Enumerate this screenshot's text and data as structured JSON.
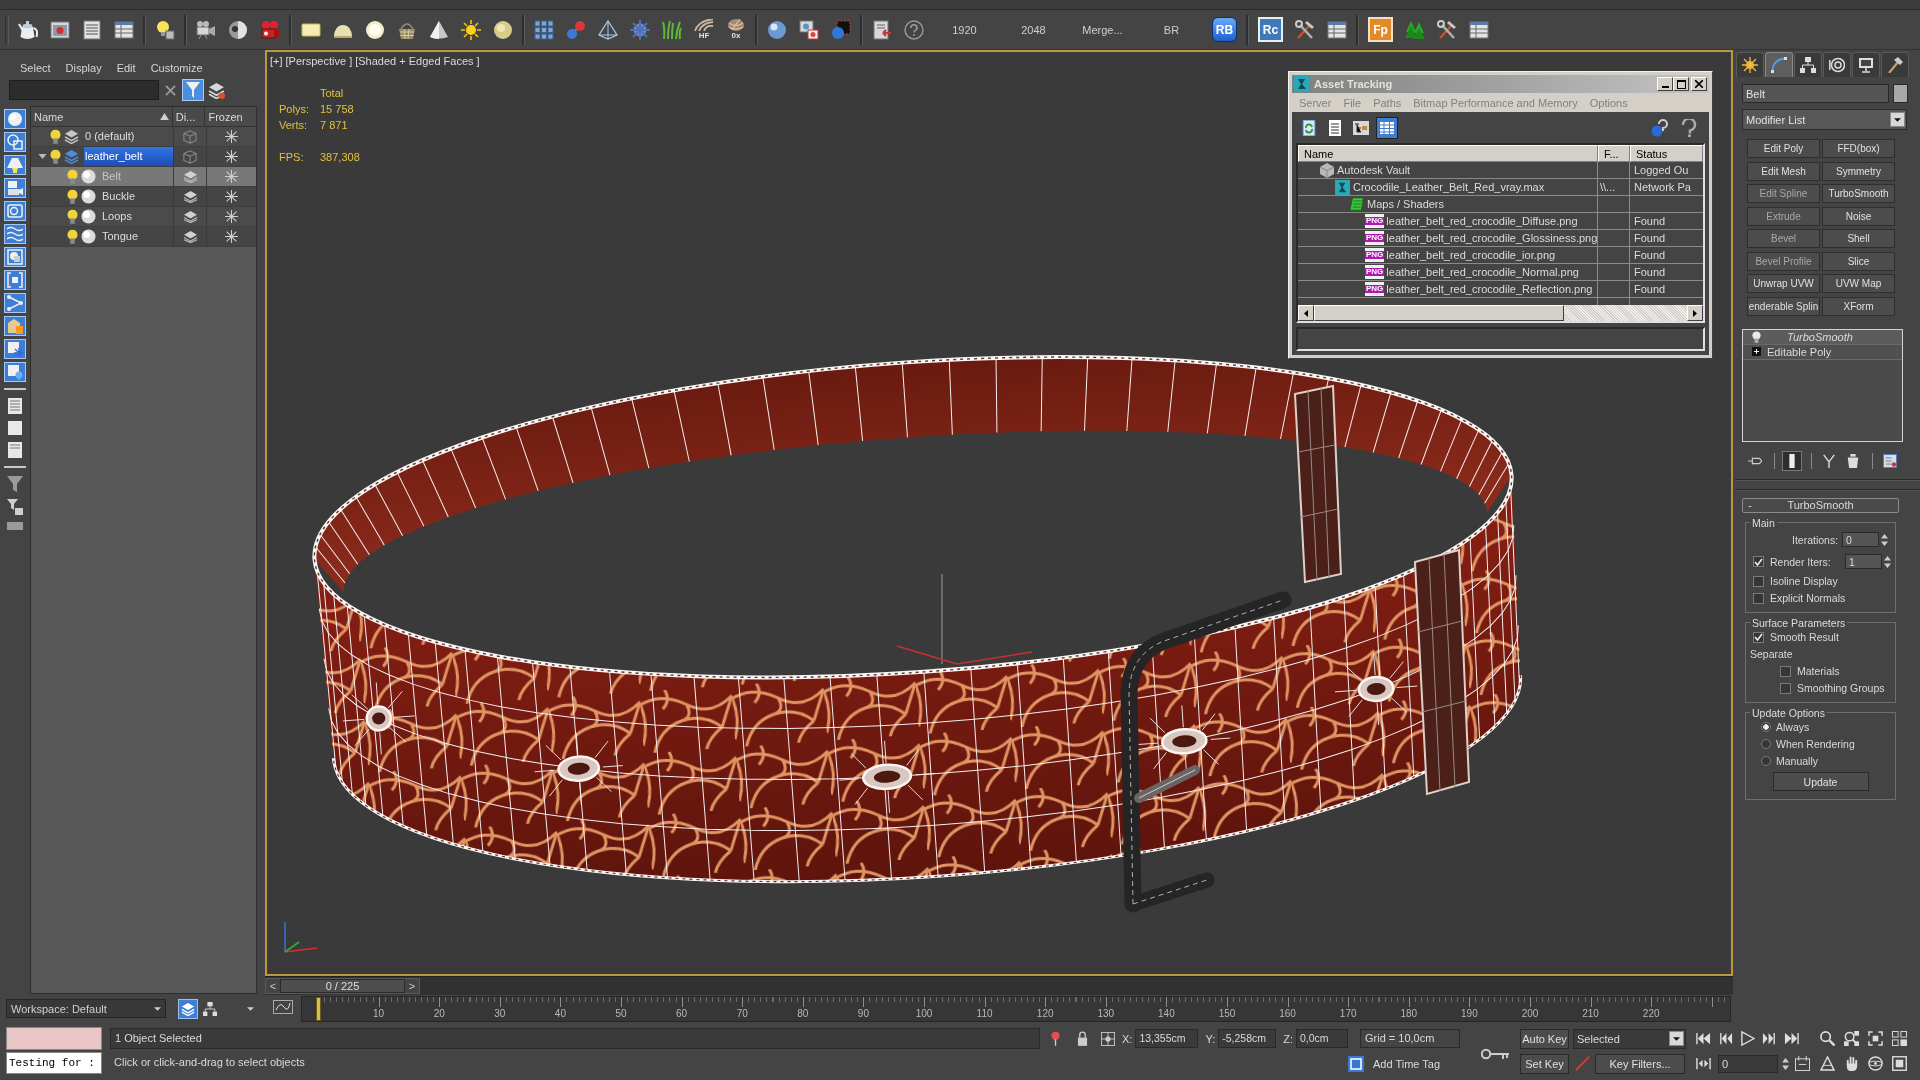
{
  "main_toolbar": {
    "icon_captions": [
      "HF",
      "0x"
    ],
    "script_buttons": [
      "1920",
      "2048",
      "Merge...",
      "BR"
    ],
    "plugin_badges": [
      "RB",
      "Rc",
      "Fp"
    ]
  },
  "scene_explorer": {
    "menu": [
      "Select",
      "Display",
      "Edit",
      "Customize"
    ],
    "filter_toggle": {
      "on": true
    },
    "display_filters": [
      {
        "on": true
      },
      {
        "on": true
      },
      {
        "on": true
      },
      {
        "on": true
      },
      {
        "on": true
      },
      {
        "on": true
      },
      {
        "on": true
      },
      {
        "on": true
      },
      {
        "on": true
      },
      {
        "on": true
      },
      {
        "on": true
      },
      {
        "on": true
      }
    ],
    "columns": [
      "Name",
      "Di...",
      "Frozen"
    ],
    "layers": [
      {
        "name": "0 (default)",
        "selected": false,
        "visible": true,
        "frozen": false
      },
      {
        "name": "leather_belt",
        "selected": true,
        "visible": true,
        "frozen": false,
        "expanded": true,
        "children": [
          {
            "name": "Belt",
            "selected": true,
            "visible": true,
            "frozen": false
          },
          {
            "name": "Buckle",
            "selected": false,
            "visible": true,
            "frozen": false
          },
          {
            "name": "Loops",
            "selected": false,
            "visible": true,
            "frozen": false
          },
          {
            "name": "Tongue",
            "selected": false,
            "visible": true,
            "frozen": false
          }
        ]
      }
    ],
    "workspace": "Workspace: Default"
  },
  "viewport": {
    "labels": [
      "[+]",
      "[Perspective ]",
      "[Shaded + Edged Faces ]"
    ],
    "stats": {
      "title": "Total",
      "counts": [
        {
          "label": "Polys:",
          "value": "15 758"
        },
        {
          "label": "Verts:",
          "value": "7 871"
        }
      ],
      "fps": {
        "label": "FPS:",
        "value": "387,308"
      }
    }
  },
  "asset_tracking": {
    "title": "Asset Tracking",
    "menu": [
      "Server",
      "File",
      "Paths",
      "Bitmap Performance and Memory",
      "Options"
    ],
    "view_buttons": [
      {
        "selected": false
      },
      {
        "selected": false
      },
      {
        "selected": false
      },
      {
        "selected": true
      }
    ],
    "columns": [
      "Name",
      "F...",
      "Status"
    ],
    "assets": [
      {
        "kind": "vault",
        "name": "Autodesk Vault",
        "status": "Logged Ou",
        "children": [
          {
            "kind": "scene",
            "name": "Crocodile_Leather_Belt_Red_vray.max",
            "path": "\\\\...",
            "status": "Network Pa",
            "children": [
              {
                "kind": "maps",
                "name": "Maps / Shaders",
                "children": [
                  {
                    "kind": "image",
                    "badge": "PNG",
                    "name": "leather_belt_red_crocodile_Diffuse.png",
                    "status": "Found"
                  },
                  {
                    "kind": "image",
                    "badge": "PNG",
                    "name": "leather_belt_red_crocodile_Glossiness.png",
                    "status": "Found"
                  },
                  {
                    "kind": "image",
                    "badge": "PNG",
                    "name": "leather_belt_red_crocodile_ior.png",
                    "status": "Found"
                  },
                  {
                    "kind": "image",
                    "badge": "PNG",
                    "name": "leather_belt_red_crocodile_Normal.png",
                    "status": "Found"
                  },
                  {
                    "kind": "image",
                    "badge": "PNG",
                    "name": "leather_belt_red_crocodile_Reflection.png",
                    "status": "Found"
                  }
                ]
              }
            ]
          }
        ]
      }
    ]
  },
  "command_panel": {
    "tabs": [
      {
        "selected": false
      },
      {
        "selected": true
      },
      {
        "selected": false
      },
      {
        "selected": false
      },
      {
        "selected": false
      },
      {
        "selected": false
      }
    ],
    "object_name": "Belt",
    "modifier_list": "Modifier List",
    "modifier_buttons": [
      {
        "label": "Edit Poly",
        "disabled": false
      },
      {
        "label": "FFD(box)",
        "disabled": false
      },
      {
        "label": "Edit Mesh",
        "disabled": false
      },
      {
        "label": "Symmetry",
        "disabled": false
      },
      {
        "label": "Edit Spline",
        "disabled": true
      },
      {
        "label": "TurboSmooth",
        "disabled": false
      },
      {
        "label": "Extrude",
        "disabled": true
      },
      {
        "label": "Noise",
        "disabled": false
      },
      {
        "label": "Bevel",
        "disabled": true
      },
      {
        "label": "Shell",
        "disabled": false
      },
      {
        "label": "Bevel Profile",
        "disabled": true
      },
      {
        "label": "Slice",
        "disabled": false
      },
      {
        "label": "Unwrap UVW",
        "disabled": false
      },
      {
        "label": "UVW Map",
        "disabled": false
      },
      {
        "label": "enderable Splin",
        "disabled": false
      },
      {
        "label": "XForm",
        "disabled": false
      }
    ],
    "stack": [
      {
        "kind": "modifier",
        "name": "TurboSmooth"
      },
      {
        "kind": "base",
        "name": "Editable Poly"
      }
    ],
    "stack_tools": [
      {
        "on": false
      },
      {
        "on": true
      },
      {
        "on": false
      },
      {
        "on": false
      },
      {
        "on": false
      }
    ],
    "rollout": {
      "sign": "-",
      "title": "TurboSmooth",
      "groups": [
        {
          "title": "Main",
          "controls": [
            {
              "kind": "spinner",
              "label": "Iterations:",
              "value": "0"
            },
            {
              "kind": "check_spinner",
              "label": "Render Iters:",
              "checked": true,
              "value": "1"
            },
            {
              "kind": "checkbox",
              "label": "Isoline Display",
              "checked": false
            },
            {
              "kind": "checkbox",
              "label": "Explicit Normals",
              "checked": false
            }
          ]
        },
        {
          "title": "Surface Parameters",
          "controls": [
            {
              "kind": "checkbox",
              "label": "Smooth Result",
              "checked": true
            },
            {
              "kind": "label",
              "label": "Separate",
              "children": [
                {
                  "kind": "checkbox",
                  "label": "Materials",
                  "checked": false
                },
                {
                  "kind": "checkbox",
                  "label": "Smoothing Groups",
                  "checked": false
                }
              ]
            }
          ]
        },
        {
          "title": "Update Options",
          "controls": [
            {
              "kind": "radio",
              "label": "Always",
              "selected": true
            },
            {
              "kind": "radio",
              "label": "When Rendering",
              "selected": false
            },
            {
              "kind": "radio",
              "label": "Manually",
              "selected": false
            },
            {
              "kind": "button",
              "label": "Update"
            }
          ]
        }
      ]
    }
  },
  "time_slider": {
    "prev": "<",
    "position": "0 / 225",
    "next": ">",
    "level": 0
  },
  "track_bar": {
    "ticks": [
      "10",
      "20",
      "30",
      "40",
      "50",
      "60",
      "70",
      "80",
      "90",
      "100",
      "110",
      "120",
      "130",
      "140",
      "150",
      "160",
      "170",
      "180",
      "190",
      "200",
      "210",
      "220"
    ]
  },
  "status_bar": {
    "listener_input": "Testing for :",
    "selection": "1 Object Selected",
    "prompt": "Click or click-and-drag to select objects",
    "coords": [
      {
        "label": "X:",
        "value": "13,355cm"
      },
      {
        "label": "Y:",
        "value": "-5,258cm"
      },
      {
        "label": "Z:",
        "value": "0,0cm"
      }
    ],
    "grid": "Grid = 10,0cm",
    "time_tag": "Add Time Tag",
    "auto_key": "Auto Key",
    "key_set": "Selected",
    "set_key": "Set Key",
    "key_filters": "Key Filters...",
    "frame": "0"
  }
}
